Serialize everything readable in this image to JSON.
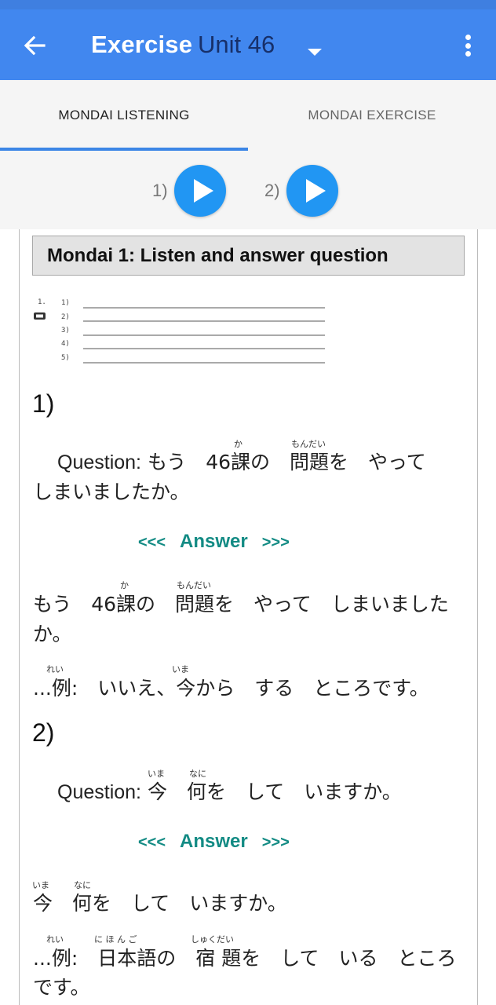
{
  "app": {
    "title": "Exercise",
    "unit_selected": "Unit 46",
    "brand_color": "#4187ef"
  },
  "tabs": [
    {
      "label": "MONDAI LISTENING",
      "active": true
    },
    {
      "label": "MONDAI EXERCISE",
      "active": false
    }
  ],
  "players": [
    {
      "label": "1)"
    },
    {
      "label": "2)"
    }
  ],
  "mondai": {
    "heading": "Mondai 1: Listen and answer question",
    "worksheet": {
      "section": "1.",
      "items": [
        "1)",
        "2)",
        "3)",
        "4)",
        "5)"
      ]
    },
    "questions": [
      {
        "number": "1)",
        "question_label": "Question:",
        "question_text": "もう　46課の　問題を　やって",
        "question_text_line2": "しまいましたか。",
        "question_ruby": [
          "か",
          "もんだい"
        ],
        "answer_toggle": {
          "left": "<<<",
          "label": "Answer",
          "right": ">>>"
        },
        "answer_line1": "もう　46課の　問題を　やって　しまいました",
        "answer_line2": "か。",
        "answer_ruby": [
          "か",
          "もんだい"
        ],
        "example": "...例:　いいえ、今から　する　ところです。",
        "example_ruby": [
          "れい",
          "いま"
        ]
      },
      {
        "number": "2)",
        "question_label": "Question:",
        "question_text": "今　何を　して　いますか。",
        "question_ruby": [
          "いま",
          "なに"
        ],
        "answer_toggle": {
          "left": "<<<",
          "label": "Answer",
          "right": ">>>"
        },
        "answer_line1": "今　何を　して　いますか。",
        "answer_ruby": [
          "いま",
          "なに"
        ],
        "example": "...例:　日本語の　宿 題を　して　いる　ところ",
        "example_line2": "です。",
        "example_ruby": [
          "れい",
          "に ほ ん ご",
          "しゅくだい"
        ]
      }
    ]
  },
  "colors": {
    "answer": "#138b84",
    "play_button": "#2196f3",
    "tab_indicator": "#3c86e6"
  }
}
